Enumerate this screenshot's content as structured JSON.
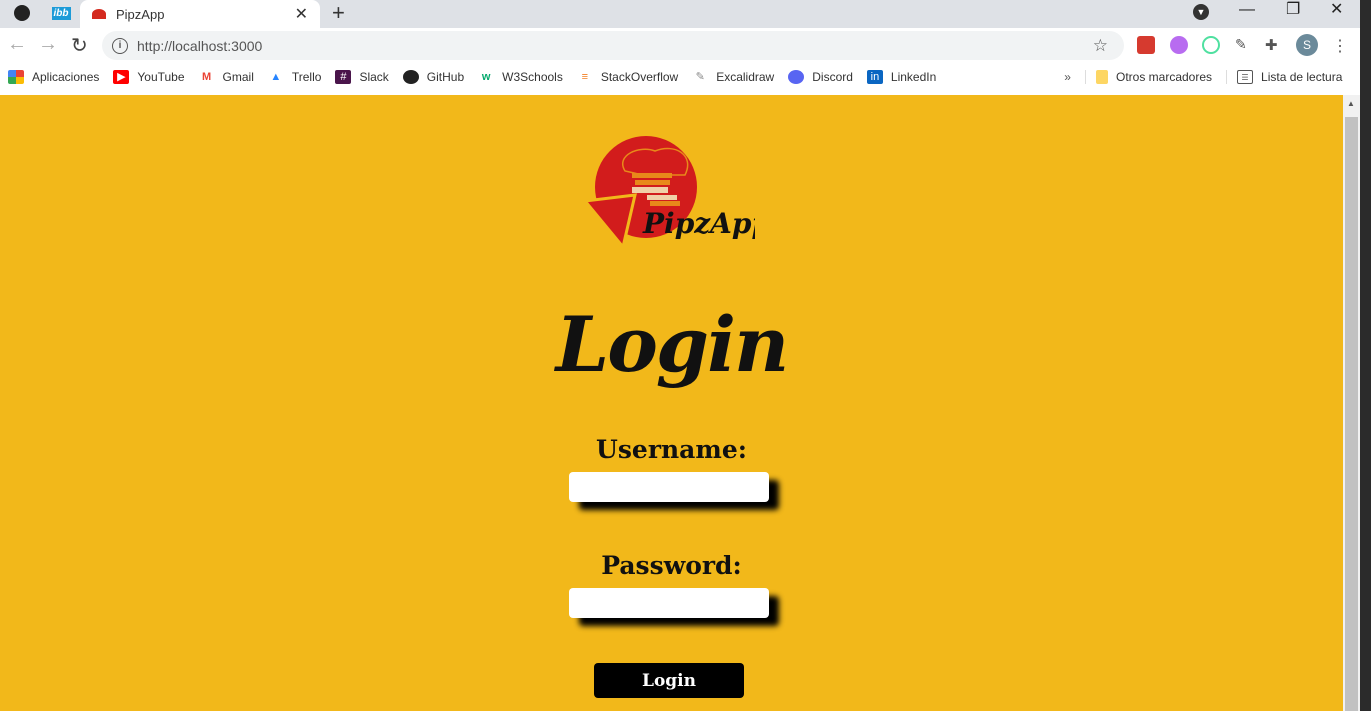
{
  "browser": {
    "tab_title": "PipzApp",
    "url": "http://localhost:3000",
    "profile_initial": "S",
    "bookmarks": [
      "Aplicaciones",
      "YouTube",
      "Gmail",
      "Trello",
      "Slack",
      "GitHub",
      "W3Schools",
      "StackOverflow",
      "Excalidraw",
      "Discord",
      "LinkedIn"
    ],
    "other_bookmarks": "Otros marcadores",
    "reading_list": "Lista de lectura",
    "pinned_tab_label": "ibb"
  },
  "page": {
    "logo_text": "PipzApp",
    "title": "Login",
    "username_label": "Username:",
    "username_value": "",
    "password_label": "Password:",
    "password_value": "",
    "submit_label": "Login",
    "background": "#f2b81a",
    "logo_color": "#d21c1c"
  }
}
